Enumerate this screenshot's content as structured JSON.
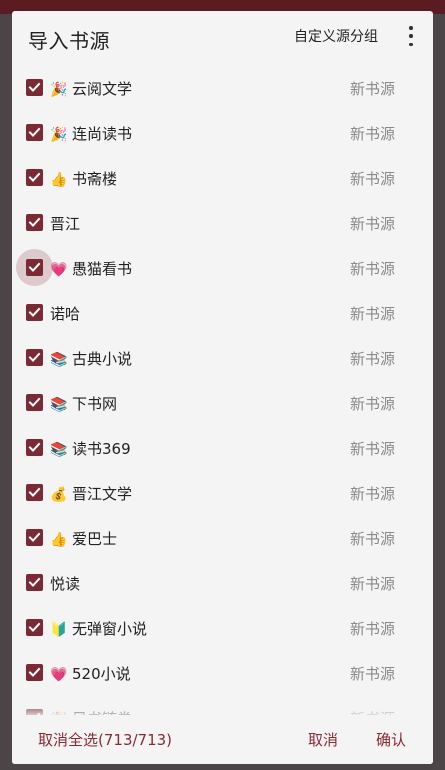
{
  "dialog": {
    "title": "导入书源",
    "custom_group_label": "自定义源分组",
    "more_icon": "more-vert-icon"
  },
  "items": [
    {
      "emoji": "🎉",
      "name": "云阅文学",
      "status": "新书源",
      "checked": true
    },
    {
      "emoji": "🎉",
      "name": "连尚读书",
      "status": "新书源",
      "checked": true
    },
    {
      "emoji": "👍",
      "name": "书斋楼",
      "status": "新书源",
      "checked": true
    },
    {
      "emoji": "",
      "name": "晋江",
      "status": "新书源",
      "checked": true
    },
    {
      "emoji": "💗",
      "name": "愚猫看书",
      "status": "新书源",
      "checked": true
    },
    {
      "emoji": "",
      "name": "诺哈",
      "status": "新书源",
      "checked": true
    },
    {
      "emoji": "📚",
      "name": "古典小说",
      "status": "新书源",
      "checked": true
    },
    {
      "emoji": "📚",
      "name": "下书网",
      "status": "新书源",
      "checked": true
    },
    {
      "emoji": "📚",
      "name": "读书369",
      "status": "新书源",
      "checked": true
    },
    {
      "emoji": "💰",
      "name": "晋江文学",
      "status": "新书源",
      "checked": true
    },
    {
      "emoji": "👍",
      "name": "爱巴士",
      "status": "新书源",
      "checked": true
    },
    {
      "emoji": "",
      "name": "悦读",
      "status": "新书源",
      "checked": true
    },
    {
      "emoji": "🔰",
      "name": "无弹窗小说",
      "status": "新书源",
      "checked": true
    },
    {
      "emoji": "💗",
      "name": "520小说",
      "status": "新书源",
      "checked": true
    },
    {
      "emoji": "🎉",
      "name": "风书链券",
      "status": "新书源",
      "checked": true
    }
  ],
  "footer": {
    "select_all_label": "取消全选(713/713)",
    "cancel_label": "取消",
    "confirm_label": "确认"
  },
  "colors": {
    "accent": "#7b2a33",
    "status_text": "#8a8a8a",
    "dialog_bg": "#f4f4f4"
  }
}
